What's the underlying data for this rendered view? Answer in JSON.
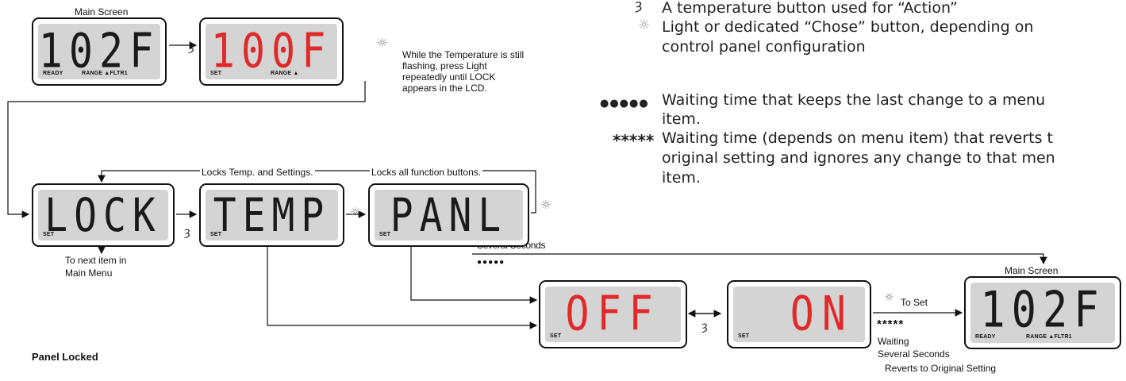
{
  "legend": {
    "temp_button": "A temperature button used for “Action”",
    "light_button_1": "Light or dedicated “Chose” button, depending on",
    "light_button_2": "control panel configuration",
    "dots_symbol": "●●●●●",
    "dots_text_1": "Waiting time that keeps the last change to a menu",
    "dots_text_2": "item.",
    "stars_symbol": "*****",
    "stars_text_1": "Waiting time (depends on menu item) that reverts t",
    "stars_text_2": "original setting and ignores any change to that men",
    "stars_text_3": "item."
  },
  "labels": {
    "main_screen_top": "Main Screen",
    "flash_note": "While the Temperature is still flashing, press Light repeatedly until LOCK appears in the LCD.",
    "locks_temp": "Locks Temp. and Settings.",
    "locks_all": "Locks all function buttons.",
    "next_item_1": "To next item in",
    "next_item_2": "Main Menu",
    "several_seconds_top": "Several Seconds",
    "dots_small": "●●●●●",
    "main_screen_right": "Main Screen",
    "to_set": "To Set",
    "stars_small": "*****",
    "waiting": "Waiting",
    "several_seconds_bottom": "Several Seconds",
    "reverts": "Reverts to Original Setting",
    "panel_locked": "Panel Locked"
  },
  "displays": {
    "main": {
      "text": "102F",
      "ind_left": "READY",
      "ind_mid": "RANGE ▲FLTR1"
    },
    "set100": {
      "text": "100F",
      "ind_left": "SET",
      "ind_mid": "RANGE ▲"
    },
    "lock": {
      "text": "LOCK",
      "ind_left": "SET"
    },
    "temp": {
      "text": "TEMP",
      "ind_left": "SET"
    },
    "panl": {
      "text": "PANL",
      "ind_left": "SET"
    },
    "off": {
      "text": "OFF",
      "ind_left": "SET"
    },
    "on": {
      "text": "ON",
      "ind_left": "SET"
    },
    "main_right": {
      "text": "102F",
      "ind_left": "READY",
      "ind_mid": "RANGE ▲FLTR1"
    }
  },
  "icons": {
    "temp": "ȝ",
    "light": "☼"
  },
  "colors": {
    "segment_red": "#e02a2a",
    "segment_black": "#1a1a1a",
    "lcd_bg": "#d4d4d4"
  }
}
